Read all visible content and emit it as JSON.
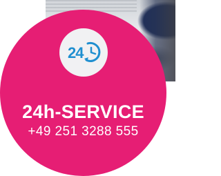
{
  "badge": {
    "icon": "24h-clock-icon",
    "title": "24h-SERVICE",
    "phone": "+49 251 3288 555",
    "color": "#e61e74"
  }
}
